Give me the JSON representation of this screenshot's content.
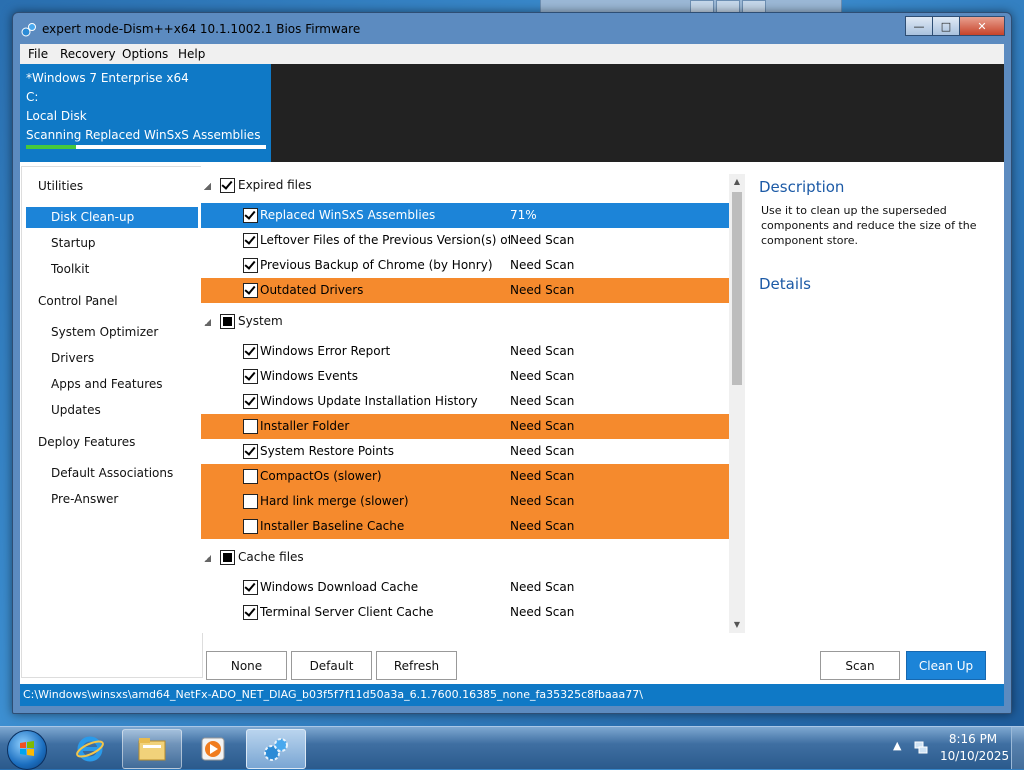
{
  "window": {
    "title": "expert mode-Dism++x64 10.1.1002.1 Bios Firmware",
    "min": "0",
    "max": "1",
    "close": "r"
  },
  "menu": [
    "File",
    "Recovery",
    "Options",
    "Help"
  ],
  "info": {
    "os": "*Windows 7 Enterprise x64",
    "drive": "C:",
    "disk": "Local Disk",
    "status": "Scanning Replaced WinSxS Assemblies",
    "progress": 0.21
  },
  "sidebar": {
    "groups": [
      {
        "label": "Utilities",
        "items": [
          "Disk Clean-up",
          "Startup",
          "Toolkit"
        ]
      },
      {
        "label": "Control Panel",
        "items": [
          "System Optimizer",
          "Drivers",
          "Apps and Features",
          "Updates"
        ]
      },
      {
        "label": "Deploy Features",
        "items": [
          "Default Associations",
          "Pre-Answer"
        ]
      }
    ],
    "selected": "Disk Clean-up"
  },
  "list": {
    "groups": [
      {
        "label": "Expired files",
        "state": "checked",
        "rows": [
          {
            "name": "Replaced WinSxS Assemblies",
            "status": "71%",
            "checked": true,
            "style": "selected"
          },
          {
            "name": "Leftover Files of the Previous Version(s) of Dism",
            "status": "Need Scan",
            "checked": true,
            "style": "normal"
          },
          {
            "name": "Previous Backup of Chrome (by Honry)",
            "status": "Need Scan",
            "checked": true,
            "style": "normal"
          },
          {
            "name": "Outdated Drivers",
            "status": "Need Scan",
            "checked": true,
            "style": "warning"
          }
        ]
      },
      {
        "label": "System",
        "state": "partial",
        "rows": [
          {
            "name": "Windows Error Report",
            "status": "Need Scan",
            "checked": true,
            "style": "normal"
          },
          {
            "name": "Windows Events",
            "status": "Need Scan",
            "checked": true,
            "style": "normal"
          },
          {
            "name": "Windows Update Installation History",
            "status": "Need Scan",
            "checked": true,
            "style": "normal"
          },
          {
            "name": "Installer Folder",
            "status": "Need Scan",
            "checked": false,
            "style": "warning"
          },
          {
            "name": "System Restore Points",
            "status": "Need Scan",
            "checked": true,
            "style": "normal"
          },
          {
            "name": "CompactOs (slower)",
            "status": "Need Scan",
            "checked": false,
            "style": "warning"
          },
          {
            "name": "Hard link merge (slower)",
            "status": "Need Scan",
            "checked": false,
            "style": "warning"
          },
          {
            "name": "Installer Baseline Cache",
            "status": "Need Scan",
            "checked": false,
            "style": "warning"
          }
        ]
      },
      {
        "label": "Cache files",
        "state": "partial",
        "rows": [
          {
            "name": "Windows Download Cache",
            "status": "Need Scan",
            "checked": true,
            "style": "normal"
          },
          {
            "name": "Terminal Server Client Cache",
            "status": "Need Scan",
            "checked": true,
            "style": "normal"
          }
        ]
      }
    ]
  },
  "description": {
    "heading": "Description",
    "text": "Use it to clean up the superseded components and reduce the size of the component store.",
    "details_heading": "Details"
  },
  "buttons": {
    "none": "None",
    "default": "Default",
    "refresh": "Refresh",
    "scan": "Scan",
    "cleanup": "Clean Up"
  },
  "path": "C:\\Windows\\winsxs\\amd64_NetFx-ADO_NET_DIAG_b03f5f7f11d50a3a_6.1.7600.16385_none_fa35325c8fbaaa77\\",
  "colors": {
    "accent": "#1c84d8",
    "info_blue": "#0f79c6",
    "warning_orange": "#f58a2d",
    "progress_green": "#46c83b",
    "heading_blue": "#1c5aa6"
  },
  "taskbar": {
    "time": "8:16 PM",
    "date": "10/10/2025",
    "tray_arrow": "▲",
    "apps": [
      "ie-icon",
      "explorer-icon",
      "media-player-icon",
      "dism-icon"
    ]
  }
}
